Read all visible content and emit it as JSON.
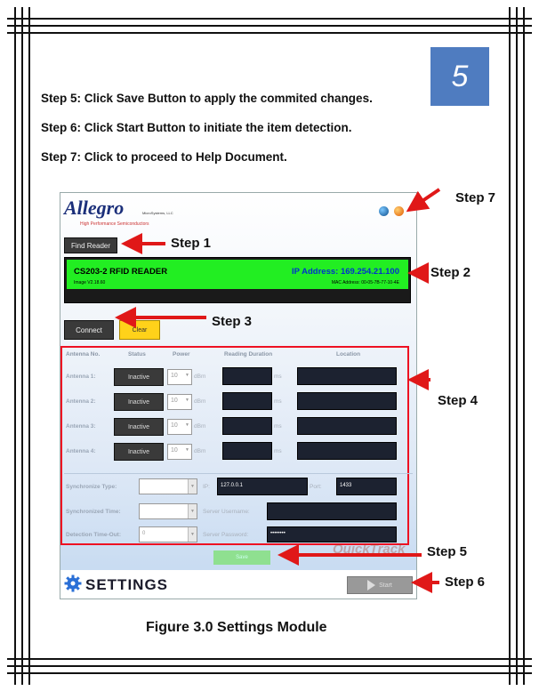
{
  "page_number": "5",
  "steps": [
    {
      "label": "Step 5",
      "text": "Step 5: Click Save Button to apply the commited changes."
    },
    {
      "label": "Step 6",
      "text": "Step 6: Click Start Button to initiate the item detection."
    },
    {
      "label": "Step 7",
      "text": "Step 7: Click to proceed to Help Document."
    }
  ],
  "callouts": {
    "step1": "Step 1",
    "step2": "Step 2",
    "step3": "Step 3",
    "step4": "Step 4",
    "step5": "Step 5",
    "step6": "Step 6",
    "step7": "Step 7"
  },
  "app": {
    "logo_text": "Allegro",
    "logo_tagline": "High Performance Semiconductors",
    "logo_small": "MicroSystems, LLC",
    "find_reader": "Find Reader",
    "reader_name": "CS203-2 RFID READER",
    "image_version": "Image V2.18.60",
    "ip_address": "IP Address: 169.254.21.100",
    "mac_address": "MAC Address: 00-05-7B-77-10-4E",
    "connect": "Connect",
    "clear": "Clear",
    "headers": {
      "antenna": "Antenna No.",
      "status": "Status",
      "power": "Power",
      "duration": "Reading Duration",
      "location": "Location"
    },
    "antennas": [
      {
        "label": "Antenna 1:",
        "status": "Inactive",
        "power": "10",
        "power_unit": "dBm",
        "duration_unit": "ms"
      },
      {
        "label": "Antenna 2:",
        "status": "Inactive",
        "power": "10",
        "power_unit": "dBm",
        "duration_unit": "ms"
      },
      {
        "label": "Antenna 3:",
        "status": "Inactive",
        "power": "10",
        "power_unit": "dBm",
        "duration_unit": "ms"
      },
      {
        "label": "Antenna 4:",
        "status": "Inactive",
        "power": "10",
        "power_unit": "dBm",
        "duration_unit": "ms"
      }
    ],
    "bottom_fields": {
      "sync_type_label": "Synchronize Type:",
      "ip_label": "IP:",
      "ip_value": "127.0.0.1",
      "port_label": "Port:",
      "port_value": "1433",
      "sync_time_label": "Synchronized Time:",
      "server_user_label": "Server Username:",
      "timeout_label": "Detection Time-Out:",
      "timeout_value": "0",
      "server_pass_label": "Server Password:",
      "server_pass_value": "••••••••"
    },
    "save": "Save",
    "settings_title": "SETTINGS",
    "start": "Start",
    "watermark": "QuickTrack"
  },
  "caption": "Figure 3.0 Settings Module",
  "colors": {
    "badge": "#4f7cc0",
    "green_panel": "#22ee22",
    "ip_text": "#0033cc",
    "red_outline": "#e12222",
    "arrow": "#e01818",
    "clear_button": "#ffd21a"
  }
}
